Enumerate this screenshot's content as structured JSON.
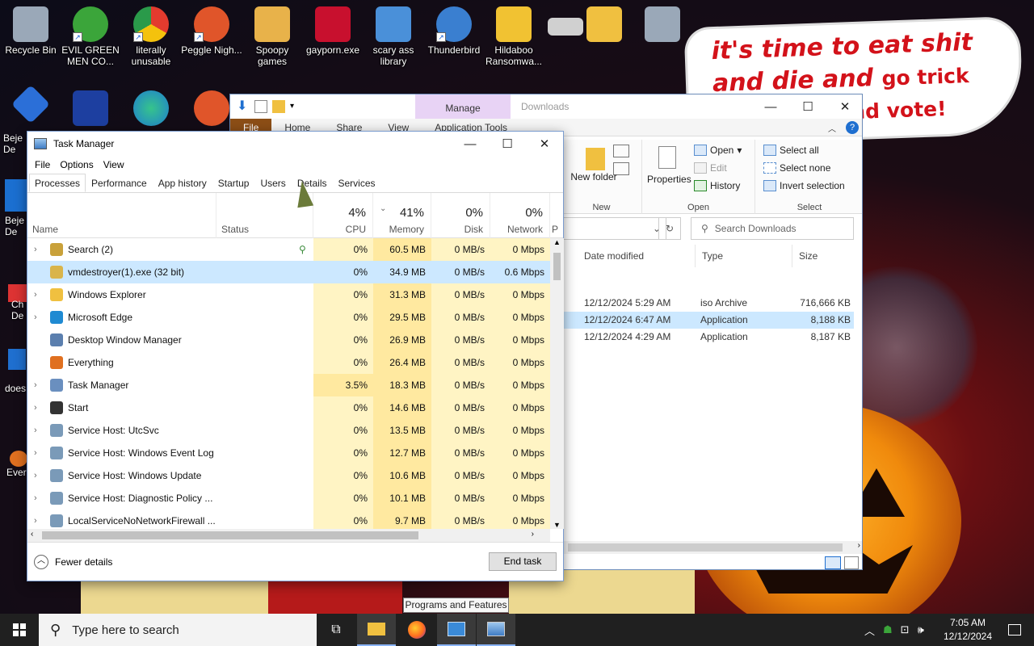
{
  "desktop": {
    "icons": [
      {
        "label": "Recycle Bin",
        "icon": "recycle-bin-icon",
        "color": "#9aa8b8"
      },
      {
        "label": "EVIL GREEN MEN CO...",
        "icon": "messenger-icon",
        "color": "#3ba53a"
      },
      {
        "label": "literally unusable",
        "icon": "chrome-icon",
        "color": "#e33b2e"
      },
      {
        "label": "Peggle Nigh...",
        "icon": "peggle-icon",
        "color": "#e0552a"
      },
      {
        "label": "Spoopy games",
        "icon": "folder-icon",
        "color": "#e8b24a"
      },
      {
        "label": "gayporn.exe",
        "icon": "flash-icon",
        "color": "#c8102e"
      },
      {
        "label": "scary ass library",
        "icon": "network-icon",
        "color": "#4a90d9"
      },
      {
        "label": "Thunderbird",
        "icon": "thunderbird-icon",
        "color": "#3a7fd0"
      },
      {
        "label": "Hildaboo Ransomwa...",
        "icon": "shield-icon",
        "color": "#f1c232"
      },
      {
        "label": "",
        "icon": "drive-icon",
        "color": "#d0d0d0"
      },
      {
        "label": "",
        "icon": "folder-icon",
        "color": "#f0c040"
      },
      {
        "label": "",
        "icon": "recycle-bin-icon",
        "color": "#9aa8b8"
      }
    ],
    "left_partials": [
      "Beje De",
      "Beje De",
      "Ch De",
      "does",
      "Ever"
    ],
    "speech_bubble": {
      "line1": "it's time to eat shit",
      "line2a": "and die and",
      "line2b": "go trick",
      "line3": "nd vote!"
    }
  },
  "explorer": {
    "manage_tab": "Manage",
    "title": "Downloads",
    "tabs": [
      "File",
      "Home",
      "Share",
      "View",
      "Application Tools"
    ],
    "ribbon": {
      "new_folder": "New folder",
      "new_group": "New",
      "properties": "Properties",
      "open": "Open",
      "edit": "Edit",
      "history": "History",
      "open_group": "Open",
      "select_all": "Select all",
      "select_none": "Select none",
      "invert_selection": "Invert selection",
      "select_group": "Select"
    },
    "search_placeholder": "Search Downloads",
    "columns": {
      "date": "Date modified",
      "type": "Type",
      "size": "Size"
    },
    "rows": [
      {
        "date": "12/12/2024 5:29 AM",
        "type": "iso Archive",
        "size": "716,666 KB"
      },
      {
        "date": "12/12/2024 6:47 AM",
        "type": "Application",
        "size": "8,188 KB"
      },
      {
        "date": "12/12/2024 4:29 AM",
        "type": "Application",
        "size": "8,187 KB"
      }
    ]
  },
  "taskmanager": {
    "title": "Task Manager",
    "menu": [
      "File",
      "Options",
      "View"
    ],
    "tabs": [
      "Processes",
      "Performance",
      "App history",
      "Startup",
      "Users",
      "Details",
      "Services"
    ],
    "header": {
      "name": "Name",
      "status": "Status",
      "cpu_pct": "4%",
      "cpu": "CPU",
      "mem_pct": "41%",
      "mem": "Memory",
      "disk_pct": "0%",
      "disk": "Disk",
      "net_pct": "0%",
      "net": "Network",
      "power": "P"
    },
    "processes": [
      {
        "name": "Search (2)",
        "expand": true,
        "cpu": "0%",
        "mem": "60.5 MB",
        "disk": "0 MB/s",
        "net": "0 Mbps",
        "color": "#c9a13a"
      },
      {
        "name": "vmdestroyer(1).exe (32 bit)",
        "expand": false,
        "cpu": "0%",
        "mem": "34.9 MB",
        "disk": "0 MB/s",
        "net": "0.6 Mbps",
        "color": "#d9b44a"
      },
      {
        "name": "Windows Explorer",
        "expand": true,
        "cpu": "0%",
        "mem": "31.3 MB",
        "disk": "0 MB/s",
        "net": "0 Mbps",
        "color": "#f0c040"
      },
      {
        "name": "Microsoft Edge",
        "expand": true,
        "cpu": "0%",
        "mem": "29.5 MB",
        "disk": "0 MB/s",
        "net": "0 Mbps",
        "color": "#1f8ad2"
      },
      {
        "name": "Desktop Window Manager",
        "expand": false,
        "cpu": "0%",
        "mem": "26.9 MB",
        "disk": "0 MB/s",
        "net": "0 Mbps",
        "color": "#5b7fae"
      },
      {
        "name": "Everything",
        "expand": false,
        "cpu": "0%",
        "mem": "26.4 MB",
        "disk": "0 MB/s",
        "net": "0 Mbps",
        "color": "#e07020"
      },
      {
        "name": "Task Manager",
        "expand": true,
        "cpu": "3.5%",
        "mem": "18.3 MB",
        "disk": "0 MB/s",
        "net": "0 Mbps",
        "color": "#6a8fbf"
      },
      {
        "name": "Start",
        "expand": true,
        "cpu": "0%",
        "mem": "14.6 MB",
        "disk": "0 MB/s",
        "net": "0 Mbps",
        "color": "#333333"
      },
      {
        "name": "Service Host: UtcSvc",
        "expand": true,
        "cpu": "0%",
        "mem": "13.5 MB",
        "disk": "0 MB/s",
        "net": "0 Mbps",
        "color": "#7a9ab8"
      },
      {
        "name": "Service Host: Windows Event Log",
        "expand": true,
        "cpu": "0%",
        "mem": "12.7 MB",
        "disk": "0 MB/s",
        "net": "0 Mbps",
        "color": "#7a9ab8"
      },
      {
        "name": "Service Host: Windows Update",
        "expand": true,
        "cpu": "0%",
        "mem": "10.6 MB",
        "disk": "0 MB/s",
        "net": "0 Mbps",
        "color": "#7a9ab8"
      },
      {
        "name": "Service Host: Diagnostic Policy ...",
        "expand": true,
        "cpu": "0%",
        "mem": "10.1 MB",
        "disk": "0 MB/s",
        "net": "0 Mbps",
        "color": "#7a9ab8"
      },
      {
        "name": "LocalServiceNoNetworkFirewall ...",
        "expand": true,
        "cpu": "0%",
        "mem": "9.7 MB",
        "disk": "0 MB/s",
        "net": "0 Mbps",
        "color": "#7a9ab8"
      }
    ],
    "fewer_details": "Fewer details",
    "end_task": "End task"
  },
  "tooltip": "Programs and Features",
  "taskbar": {
    "search_placeholder": "Type here to search",
    "time": "7:05 AM",
    "date": "12/12/2024",
    "accent": "#8ab4f8"
  }
}
